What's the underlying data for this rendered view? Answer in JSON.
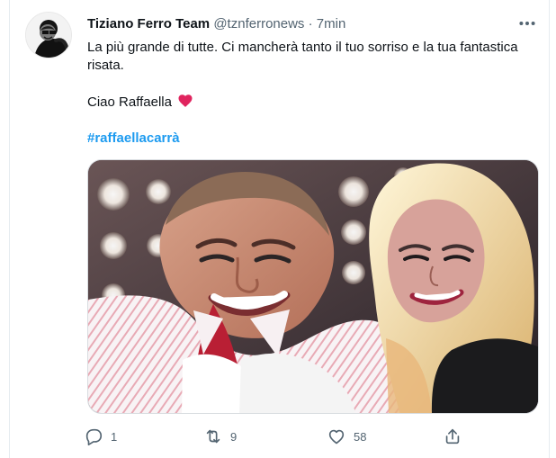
{
  "tweet": {
    "author_name": "Tiziano Ferro Team",
    "author_handle": "@tznferronews",
    "separator": "·",
    "timestamp": "7min",
    "text_line_1": "La più grande di tutte. Ci mancherà tanto il tuo sorriso e la tua fantastica",
    "text_line_2": "risata.",
    "text_line_3": "Ciao Raffaella",
    "hashtag": "#raffaellacarrà"
  },
  "actions": {
    "reply_count": "1",
    "retweet_count": "9",
    "like_count": "58"
  },
  "colors": {
    "accent": "#1d9bf0",
    "muted_text": "#536471",
    "heart": "#e0245e"
  },
  "icons": {
    "more": "more-icon",
    "reply": "reply-icon",
    "retweet": "retweet-icon",
    "like": "like-icon",
    "share": "share-icon",
    "heart_emoji": "heart-emoji-icon"
  }
}
